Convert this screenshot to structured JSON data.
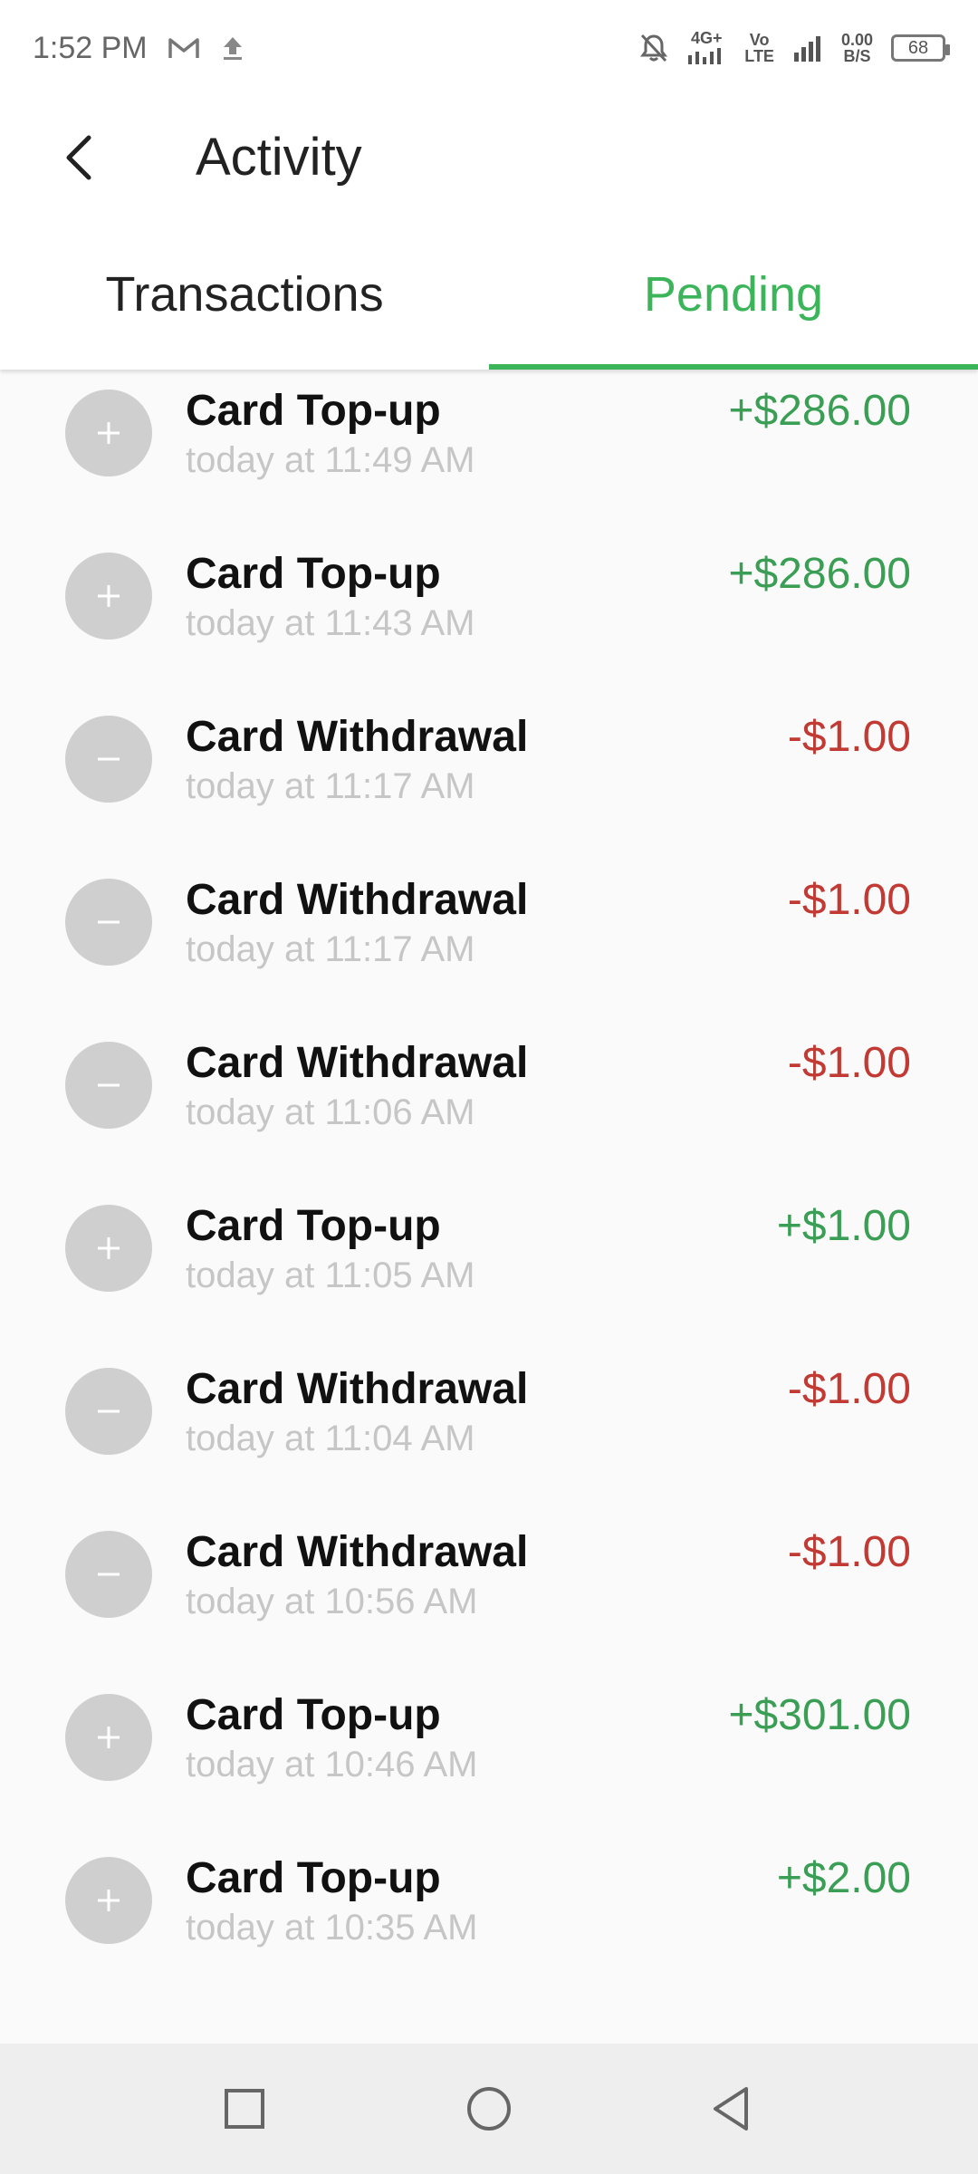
{
  "status_bar": {
    "time": "1:52 PM",
    "network_4g": "4G+",
    "volte_top": "Vo",
    "volte_bottom": "LTE",
    "speed_value": "0.00",
    "speed_unit": "B/S",
    "battery": "68",
    "icons": [
      "gmail-icon",
      "upload-icon",
      "mute-icon",
      "signal-icon"
    ]
  },
  "header": {
    "title": "Activity"
  },
  "tabs": [
    {
      "label": "Transactions",
      "active": false
    },
    {
      "label": "Pending",
      "active": true
    }
  ],
  "transactions": [
    {
      "title": "Card Top-up",
      "time": "today at 11:49 AM",
      "amount": "+$286.00",
      "type": "credit"
    },
    {
      "title": "Card Top-up",
      "time": "today at 11:43 AM",
      "amount": "+$286.00",
      "type": "credit"
    },
    {
      "title": "Card Withdrawal",
      "time": "today at 11:17 AM",
      "amount": "-$1.00",
      "type": "debit"
    },
    {
      "title": "Card Withdrawal",
      "time": "today at 11:17 AM",
      "amount": "-$1.00",
      "type": "debit"
    },
    {
      "title": "Card Withdrawal",
      "time": "today at 11:06 AM",
      "amount": "-$1.00",
      "type": "debit"
    },
    {
      "title": "Card Top-up",
      "time": "today at 11:05 AM",
      "amount": "+$1.00",
      "type": "credit"
    },
    {
      "title": "Card Withdrawal",
      "time": "today at 11:04 AM",
      "amount": "-$1.00",
      "type": "debit"
    },
    {
      "title": "Card Withdrawal",
      "time": "today at 10:56 AM",
      "amount": "-$1.00",
      "type": "debit"
    },
    {
      "title": "Card Top-up",
      "time": "today at 10:46 AM",
      "amount": "+$301.00",
      "type": "credit"
    },
    {
      "title": "Card Top-up",
      "time": "today at 10:35 AM",
      "amount": "+$2.00",
      "type": "credit"
    }
  ],
  "colors": {
    "accent": "#3cb55a",
    "credit": "#3a9e55",
    "debit": "#c23a34",
    "avatar": "#cfcfcf"
  },
  "nav_bar": {
    "icons": [
      "recents-square-icon",
      "home-circle-icon",
      "back-triangle-icon"
    ]
  }
}
